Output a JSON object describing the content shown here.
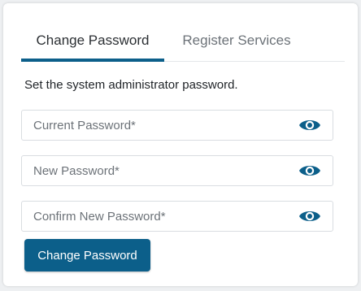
{
  "tabs": [
    {
      "label": "Change Password",
      "active": true
    },
    {
      "label": "Register Services",
      "active": false
    }
  ],
  "description": "Set the system administrator password.",
  "fields": [
    {
      "placeholder": "Current Password*",
      "value": "",
      "icon": "eye-icon"
    },
    {
      "placeholder": "New Password*",
      "value": "",
      "icon": "eye-icon"
    },
    {
      "placeholder": "Confirm New Password*",
      "value": "",
      "icon": "eye-icon"
    }
  ],
  "submit_label": "Change Password",
  "colors": {
    "accent": "#0c5f8a",
    "card_bg": "#ffffff",
    "page_bg": "#eef0f2"
  }
}
